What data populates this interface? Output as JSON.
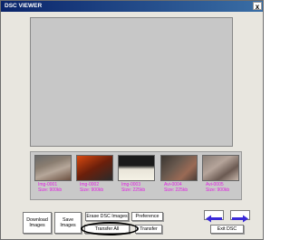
{
  "window": {
    "title": "DSC VIEWER",
    "close_glyph": "x"
  },
  "thumbnails": [
    {
      "name": "Img-0001",
      "size": "Size: 900kb"
    },
    {
      "name": "Img-0002",
      "size": "Size: 900kb"
    },
    {
      "name": "Img-0003",
      "size": "Size: 225kb"
    },
    {
      "name": "Avi-0004",
      "size": "Size: 225kb"
    },
    {
      "name": "Avi-0005",
      "size": "Size: 900kb"
    }
  ],
  "buttons": {
    "download": "Download Images",
    "save": "Save Images",
    "erase": "Erase DSC Images",
    "preference": "Preference",
    "transfer_all": "Transfer All",
    "transfer": "Transfer",
    "exit": "Exit DSC"
  },
  "icons": {
    "prev": "left-arrow-icon",
    "next": "right-arrow-icon"
  },
  "colors": {
    "label": "#e020e0",
    "arrow": "#3a2ad8",
    "titlebar": "#0a246a"
  }
}
